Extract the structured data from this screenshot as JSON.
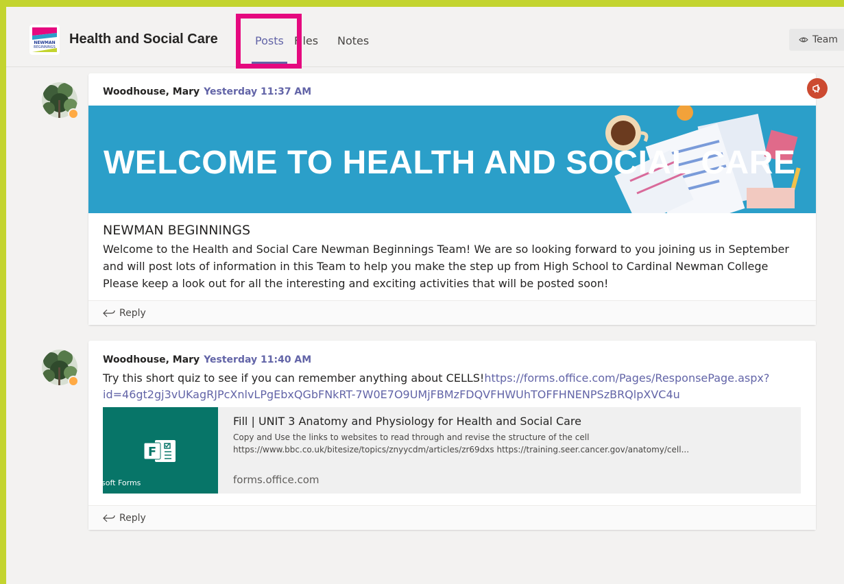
{
  "header": {
    "team_name": "Health and Social Care",
    "tabs": [
      {
        "label": "Posts",
        "active": true
      },
      {
        "label": "Files",
        "active": false
      },
      {
        "label": "Notes",
        "active": false
      }
    ],
    "team_button_label": "Team"
  },
  "posts": [
    {
      "author": "Woodhouse, Mary",
      "time": "Yesterday 11:37 AM",
      "banner_text": "WELCOME TO HEALTH AND SOCIAL CARE",
      "title": "NEWMAN BEGINNINGS",
      "body_lines": [
        "Welcome to the Health and Social Care Newman Beginnings Team! We are so looking forward to you joining us in September",
        "and will post lots of information in this Team to help you make the step up from High School to Cardinal Newman College",
        "Please keep a look out for all the interesting and exciting activities that will be posted soon!"
      ],
      "reply_label": "Reply"
    },
    {
      "author": "Woodhouse, Mary",
      "time": "Yesterday 11:40 AM",
      "text": "Try this short quiz to see if you can remember anything about CELLS!",
      "link_line1": "https://forms.office.com/Pages/ResponsePage.aspx?",
      "link_line2": "id=46gt2gj3vUKagRJPcXnlvLPgEbxQGbFNkRT-7W0E7O9UMjFBMzFDQVFHWUhTOFFHNENPSzBRQlpXVC4u",
      "preview": {
        "title": "Fill | UNIT 3 Anatomy and Physiology for Health and Social Care",
        "desc_line1": "Copy and Use the links to websites to read through and revise the structure of the cell",
        "desc_line2": "https://www.bbc.co.uk/bitesize/topics/znyycdm/articles/zr69dxs https://training.seer.cancer.gov/anatomy/cell...",
        "domain": "forms.office.com",
        "thumb_label": "soft Forms"
      },
      "reply_label": "Reply"
    }
  ],
  "colors": {
    "accent": "#6264a7",
    "frame": "#c3d42f",
    "highlight": "#e5097f",
    "banner": "#2b9fc9",
    "forms_green": "#077568"
  }
}
